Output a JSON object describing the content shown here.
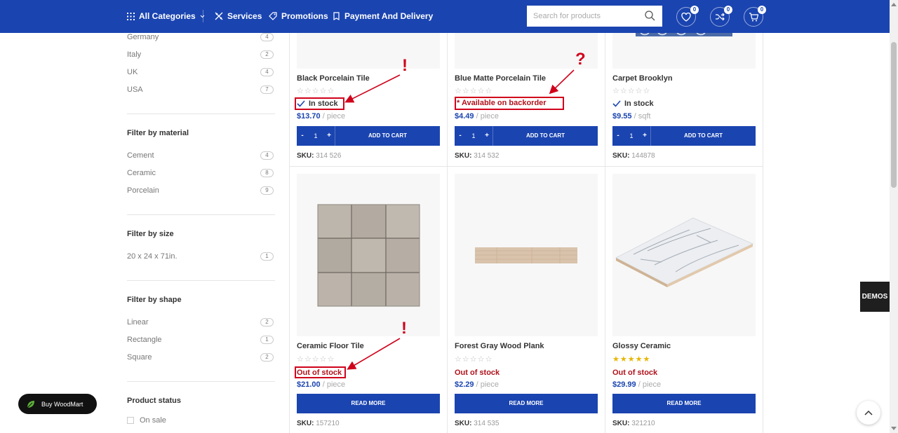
{
  "header": {
    "all_categories": "All Categories",
    "services": "Services",
    "promotions": "Promotions",
    "payment": "Payment And Delivery",
    "search_placeholder": "Search for products",
    "wishlist_count": "0",
    "compare_count": "0",
    "cart_count": "0"
  },
  "sidebar": {
    "countries": [
      {
        "label": "Germany",
        "count": "4"
      },
      {
        "label": "Italy",
        "count": "2"
      },
      {
        "label": "UK",
        "count": "4"
      },
      {
        "label": "USA",
        "count": "7"
      }
    ],
    "material": {
      "title": "Filter by material",
      "items": [
        {
          "label": "Cement",
          "count": "4"
        },
        {
          "label": "Ceramic",
          "count": "8"
        },
        {
          "label": "Porcelain",
          "count": "9"
        }
      ]
    },
    "size": {
      "title": "Filter by size",
      "items": [
        {
          "label": "20 x 24 x 71in.",
          "count": "1"
        }
      ]
    },
    "shape": {
      "title": "Filter by shape",
      "items": [
        {
          "label": "Linear",
          "count": "2"
        },
        {
          "label": "Rectangle",
          "count": "1"
        },
        {
          "label": "Square",
          "count": "2"
        }
      ]
    },
    "status": {
      "title": "Product status",
      "on_sale": "On sale"
    }
  },
  "products": [
    {
      "name": "Black Porcelain Tile",
      "stock": "In stock",
      "price": "$13.70",
      "unit": "/ piece",
      "qty": "1",
      "action": "ADD TO CART",
      "sku_label": "SKU:",
      "sku": "314 526"
    },
    {
      "name": "Blue Matte Porcelain Tile",
      "stock": "Available on backorder",
      "price": "$4.49",
      "unit": "/ piece",
      "qty": "1",
      "action": "ADD TO CART",
      "sku_label": "SKU:",
      "sku": "314 532"
    },
    {
      "name": "Carpet Brooklyn",
      "stock": "In stock",
      "price": "$9.55",
      "unit": "/ sqft",
      "qty": "1",
      "action": "ADD TO CART",
      "sku_label": "SKU:",
      "sku": "144878"
    },
    {
      "name": "Ceramic Floor Tile",
      "stock": "Out of stock",
      "price": "$21.00",
      "unit": "/ piece",
      "action": "READ MORE",
      "sku_label": "SKU:",
      "sku": "157210"
    },
    {
      "name": "Forest Gray Wood Plank",
      "stock": "Out of stock",
      "price": "$2.29",
      "unit": "/ piece",
      "action": "READ MORE",
      "sku_label": "SKU:",
      "sku": "314 535"
    },
    {
      "name": "Glossy Ceramic",
      "stock": "Out of stock",
      "price": "$29.99",
      "unit": "/ piece",
      "action": "READ MORE",
      "sku_label": "SKU:",
      "sku": "321210",
      "rating": 5
    }
  ],
  "annotations": {
    "exclaim": "!",
    "question": "?"
  },
  "widgets": {
    "demos": "DEMOS",
    "buy": "Buy WoodMart"
  },
  "colors": {
    "brand_blue": "#1a44b0",
    "annotation_red": "#d0021b",
    "out_of_stock": "#b0121b",
    "star_gold": "#e8b500"
  },
  "icons": [
    "grid-icon",
    "services-icon",
    "tag-icon",
    "payment-icon",
    "search-icon",
    "heart-icon",
    "shuffle-icon",
    "cart-icon",
    "check-icon",
    "leaf-icon",
    "chevron-up-icon"
  ]
}
